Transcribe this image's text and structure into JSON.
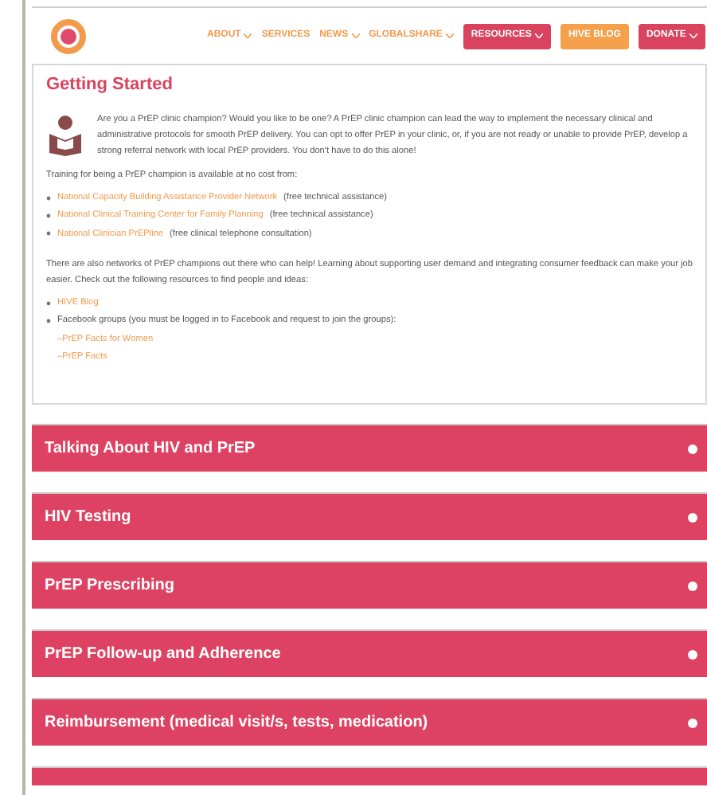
{
  "nav": [
    {
      "label": "ABOUT",
      "kind": "dropdown"
    },
    {
      "label": "SERVICES",
      "kind": "link"
    },
    {
      "label": "NEWS",
      "kind": "dropdown"
    },
    {
      "label": "GLOBALSHARE",
      "kind": "dropdown"
    },
    {
      "label": "RESOURCES",
      "kind": "button-dropdown"
    },
    {
      "label": "HIVE BLOG",
      "kind": "button"
    },
    {
      "label": "DONATE",
      "kind": "button-dropdown"
    }
  ],
  "card": {
    "title": "Getting Started",
    "intro": "Are you a PrEP clinic champion? Would you like to be one? A PrEP clinic champion can lead the way to implement the necessary clinical and administrative protocols for smooth PrEP delivery. You can opt to offer PrEP in your clinic, or, if you are not ready or unable to provide PrEP, develop a strong referral network with local PrEP providers. You don't have to do this alone!",
    "training": "Training for being a PrEP champion is available at no cost from:",
    "training_list": [
      {
        "link": "National Capacity Building Assistance Provider Network",
        "note": "(free technical assistance)"
      },
      {
        "link": "National Clinical Training Center for Family Planning",
        "note": "(free technical assistance)"
      },
      {
        "link": "National Clinician PrEPline",
        "note": "(free clinical telephone consultation)"
      }
    ],
    "networks": "There are also networks of PrEP champions out there who can help! Learning about supporting user demand and integrating consumer feedback can make your job easier. Check out the following resources to find people and ideas:",
    "resources": [
      {
        "link": "HIVE Blog"
      },
      {
        "text": "Facebook groups (you must be logged in to Facebook and request to join the groups):",
        "sublinks": [
          "–PrEP Facts for Women",
          "–PrEP Facts"
        ]
      }
    ]
  },
  "accordions": [
    {
      "kind": "titled",
      "title": "Talking About HIV and PrEP"
    },
    {
      "kind": "titled",
      "title": "HIV Testing"
    },
    {
      "kind": "titled",
      "title": "PrEP Prescribing"
    },
    {
      "kind": "titled",
      "title": "PrEP Follow-up and Adherence"
    },
    {
      "kind": "titled",
      "title": "Reimbursement (medical visit/s, tests, medication)"
    },
    {
      "kind": "cut-off"
    }
  ]
}
